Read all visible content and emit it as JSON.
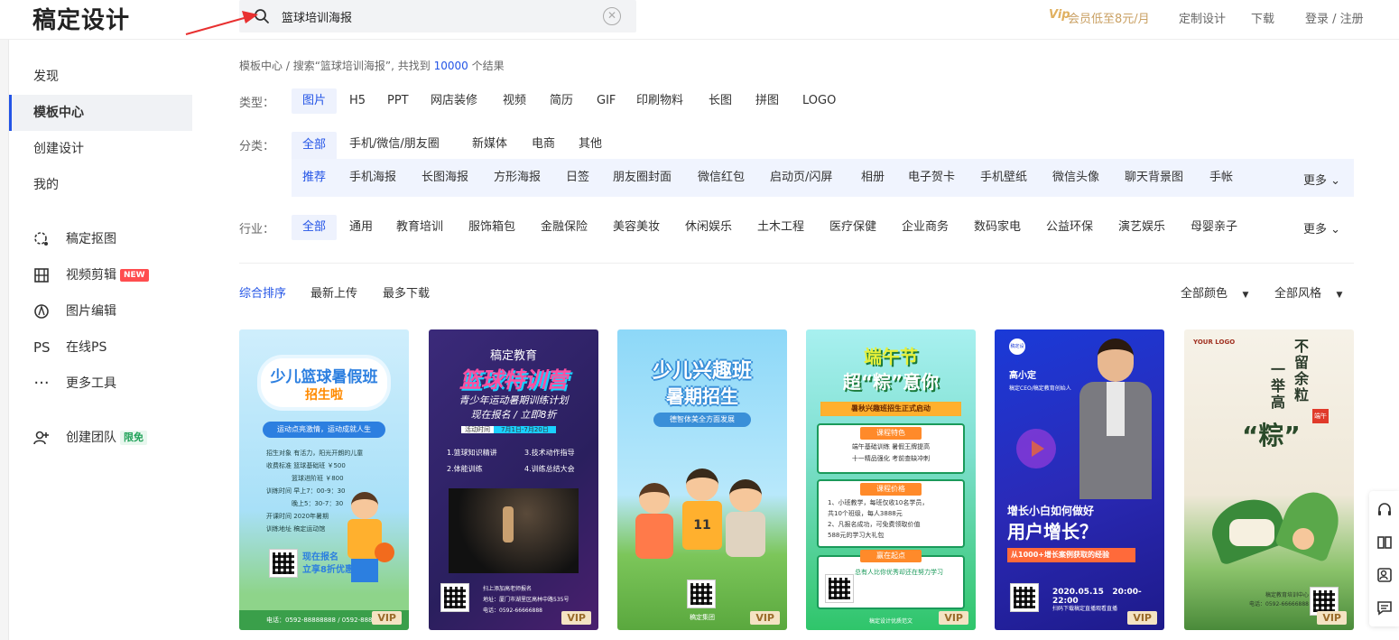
{
  "header": {
    "logo": "稿定设计",
    "search_value": "篮球培训海报",
    "vip_promo": "会员低至8元/月",
    "vip_badge": "Vip",
    "custom_design": "定制设计",
    "download": "下载",
    "login": "登录 / 注册"
  },
  "sidebar": {
    "items": [
      {
        "label": "发现"
      },
      {
        "label": "模板中心"
      },
      {
        "label": "创建设计"
      },
      {
        "label": "我的"
      }
    ],
    "tools": [
      {
        "label": "稿定抠图"
      },
      {
        "label": "视频剪辑",
        "badge": "NEW"
      },
      {
        "label": "图片编辑"
      },
      {
        "label": "在线PS",
        "icon_text": "PS"
      },
      {
        "label": "更多工具"
      },
      {
        "label": "创建团队",
        "badge": "限免"
      }
    ]
  },
  "breadcrumb": {
    "root": "模板中心",
    "sep": " / ",
    "prefix": "搜索“篮球培训海报”, 共找到 ",
    "count": "10000",
    "suffix": " 个结果"
  },
  "filters": {
    "type_label": "类型：",
    "types": [
      "图片",
      "H5",
      "PPT",
      "网店装修",
      "视频",
      "简历",
      "GIF",
      "印刷物料",
      "长图",
      "拼图",
      "LOGO"
    ],
    "category_label": "分类：",
    "categories": [
      "全部",
      "手机/微信/朋友圈",
      "新媒体",
      "电商",
      "其他"
    ],
    "subcategories": [
      "推荐",
      "手机海报",
      "长图海报",
      "方形海报",
      "日签",
      "朋友圈封面",
      "微信红包",
      "启动页/闪屏",
      "相册",
      "电子贺卡",
      "手机壁纸",
      "微信头像",
      "聊天背景图",
      "手帐"
    ],
    "industry_label": "行业：",
    "industries": [
      "全部",
      "通用",
      "教育培训",
      "服饰箱包",
      "金融保险",
      "美容美妆",
      "休闲娱乐",
      "土木工程",
      "医疗保健",
      "企业商务",
      "数码家电",
      "公益环保",
      "演艺娱乐",
      "母婴亲子"
    ],
    "more": "更多"
  },
  "sort": {
    "options": [
      "综合排序",
      "最新上传",
      "最多下载"
    ],
    "color_filter": "全部颜色",
    "style_filter": "全部风格"
  },
  "cards": [
    {
      "title": "少儿篮球暑假班",
      "subtitle": "招生啦",
      "tagline": "运动点亮激情，运动成就人生",
      "lines": [
        "招生对象  有活力，阳光开朗的儿童",
        "收费标准  篮球基础班 ￥500",
        "篮球进阶班 ￥800",
        "训练时间  早上7：00-9：30",
        "晚上5：30-7：30",
        "开课时间  2020年暑期",
        "训练地址  稿定运动馆"
      ],
      "cta": "现在报名",
      "cta2": "立享8折优惠",
      "footer": "电话：0592-88888888 / 0592-88888666",
      "vip": "VIP"
    },
    {
      "brand": "稿定教育",
      "title": "篮球特训营",
      "subtitle": "青少年运动暑期训练计划",
      "tagline": "现在报名 / 立即8折",
      "date_label": "活动时间",
      "date": "7月1日-7月20日",
      "items": [
        "1.篮球知识精讲",
        "3.技术动作指导",
        "2.体能训练",
        "4.训练总结大会"
      ],
      "note": "扫上添加高老师报名",
      "addr": "地址：厦门市湖里区高林中路535号",
      "phone": "电话：0592-66666888",
      "vip": "VIP"
    },
    {
      "title": "少儿兴趣班",
      "subtitle": "暑期招生",
      "tagline": "德智体美全方面发展",
      "footer": "稿定集团",
      "vip": "VIP"
    },
    {
      "title": "端午节",
      "subtitle": "超“粽”意你",
      "tagline": "暑秋兴趣班招生正式启动",
      "s1": "课程特色",
      "s1a": "端午基础训练   暑假王牌提高",
      "s1b": "十一精品强化   考前查缺冲刺",
      "s2": "课程价格",
      "s2a": "1、小班教学，每班仅收10名学员，",
      "s2b": "共10个班级，每人3888元",
      "s2c": "2、凡报名成功，可免费领取价值",
      "s2d": "588元的学习大礼包",
      "s3": "赢在起点",
      "s3a": "总有人比你优秀却还在努力学习",
      "footer": "稿定设计优质范文",
      "vip": "VIP"
    },
    {
      "logo": "稿定设计",
      "name": "高小定",
      "bio": "稿定CEO/稿定教育创始人",
      "title": "增长小白如何做好",
      "subtitle": "用户增长？",
      "tagline": "从1000+增长案例获取的经验",
      "date": "2020.05.15",
      "time": "20:00-22:00",
      "footer": "扫码下载稿定直播观看直播",
      "vip": "VIP"
    },
    {
      "logo": "YOUR LOGO",
      "title": "不留余粒",
      "subtitle": "一举高",
      "big": "“粽”",
      "tag": "端午",
      "footer": "稿定教育培训中心",
      "phone": "电话：0592-66666888",
      "vip": "VIP"
    }
  ]
}
